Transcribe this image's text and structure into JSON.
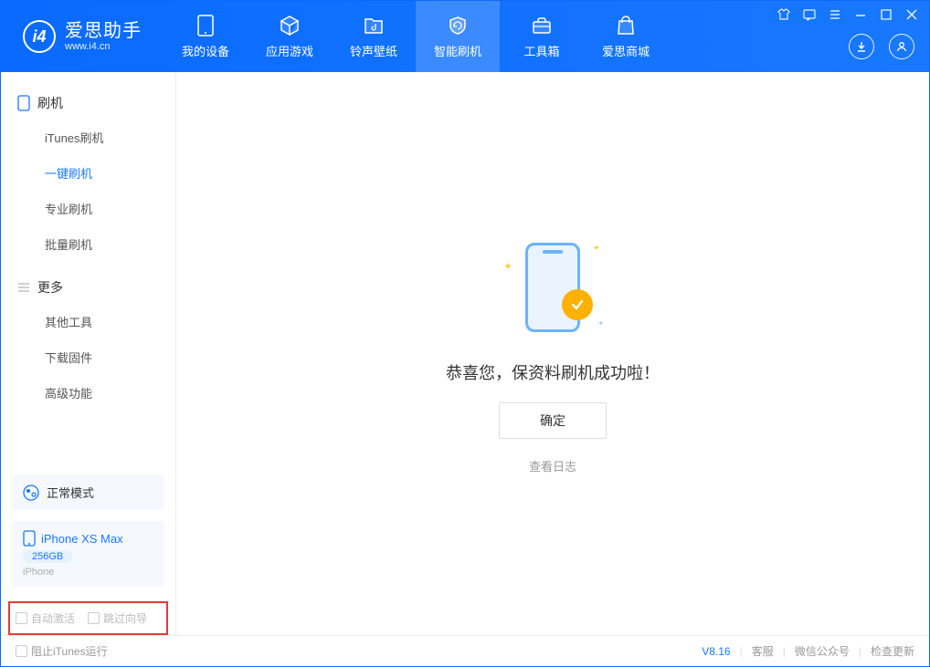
{
  "app": {
    "name": "爱思助手",
    "url": "www.i4.cn"
  },
  "tabs": {
    "device": "我的设备",
    "apps": "应用游戏",
    "wallpaper": "铃声壁纸",
    "flash": "智能刷机",
    "toolbox": "工具箱",
    "store": "爱思商城"
  },
  "sidebar": {
    "section_flash": "刷机",
    "items_flash": {
      "itunes": "iTunes刷机",
      "oneclick": "一键刷机",
      "pro": "专业刷机",
      "batch": "批量刷机"
    },
    "section_more": "更多",
    "items_more": {
      "other": "其他工具",
      "firmware": "下载固件",
      "advanced": "高级功能"
    }
  },
  "mode": {
    "label": "正常模式"
  },
  "device": {
    "name": "iPhone XS Max",
    "storage": "256GB",
    "type": "iPhone"
  },
  "checks": {
    "auto_activate": "自动激活",
    "skip_guide": "跳过向导"
  },
  "main": {
    "message": "恭喜您，保资料刷机成功啦！",
    "ok": "确定",
    "view_log": "查看日志"
  },
  "status": {
    "block_itunes": "阻止iTunes运行",
    "version": "V8.16",
    "support": "客服",
    "wechat": "微信公众号",
    "update": "检查更新"
  }
}
